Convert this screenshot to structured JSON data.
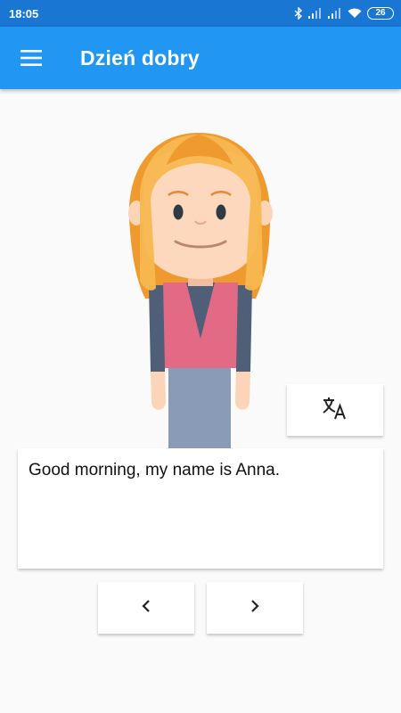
{
  "status_bar": {
    "time": "18:05",
    "battery": "26",
    "icons": [
      "bluetooth-icon",
      "signal-icon",
      "signal-icon",
      "wifi-icon",
      "battery-icon"
    ]
  },
  "app_bar": {
    "title": "Dzień dobry",
    "menu_icon": "hamburger-menu-icon",
    "color": "#2196f3"
  },
  "main": {
    "character": "girl-avatar",
    "translate_icon": "translate-icon",
    "sentence": "Good morning, my name is Anna.",
    "prev_icon": "chevron-left-icon",
    "next_icon": "chevron-right-icon"
  }
}
